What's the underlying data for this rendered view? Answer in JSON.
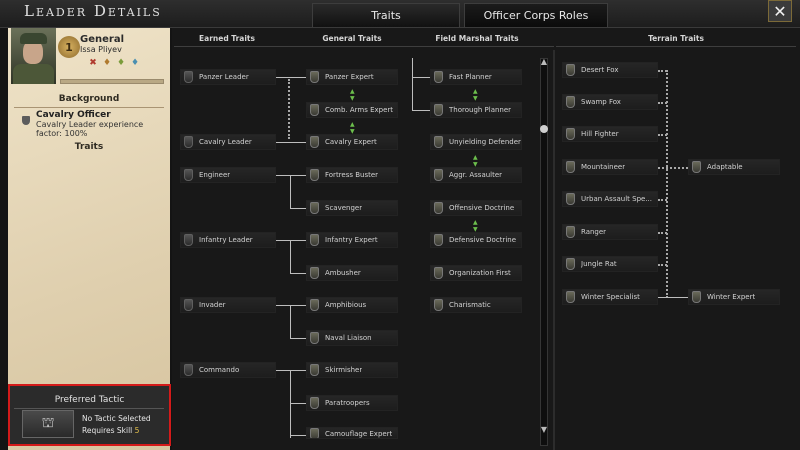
{
  "window": {
    "title": "Leader Details",
    "close_label": "✕"
  },
  "tabs": [
    {
      "label": "Traits",
      "active": true
    },
    {
      "label": "Officer Corps Roles",
      "active": false
    }
  ],
  "leader": {
    "rank_label": "General",
    "rank_number": "1",
    "name": "Issa Pliyev",
    "background_heading": "Background",
    "background_name": "Cavalry Officer",
    "background_desc": "Cavalry Leader experience factor: 100%",
    "traits_heading": "Traits"
  },
  "tactic": {
    "heading": "Preferred Tactic",
    "status": "No Tactic Selected",
    "requires_label": "Requires Skill",
    "requires_value": "5"
  },
  "columns": {
    "earned": "Earned Traits",
    "general": "General Traits",
    "field_marshal": "Field Marshal Traits",
    "terrain": "Terrain Traits"
  },
  "earned_traits": [
    "Panzer Leader",
    "Cavalry Leader",
    "Engineer",
    "Infantry Leader",
    "Invader",
    "Commando"
  ],
  "general_traits": [
    "Panzer Expert",
    "Comb. Arms Expert",
    "Cavalry Expert",
    "Fortress Buster",
    "Scavenger",
    "Infantry Expert",
    "Ambusher",
    "Amphibious",
    "Naval Liaison",
    "Skirmisher",
    "Paratroopers",
    "Camouflage Expert"
  ],
  "field_marshal_traits": [
    "Fast Planner",
    "Thorough Planner",
    "Unyielding Defender",
    "Aggr. Assaulter",
    "Offensive Doctrine",
    "Defensive Doctrine",
    "Organization First",
    "Charismatic"
  ],
  "terrain_traits": [
    "Desert Fox",
    "Swamp Fox",
    "Hill Fighter",
    "Mountaineer",
    "Urban Assault Spe...",
    "Ranger",
    "Jungle Rat",
    "Winter Specialist",
    "Adaptable",
    "Winter Expert"
  ],
  "colors": {
    "highlight": "#d41a1a",
    "skill_value": "#e5c14a",
    "link_arrow": "#6cbf4c"
  }
}
